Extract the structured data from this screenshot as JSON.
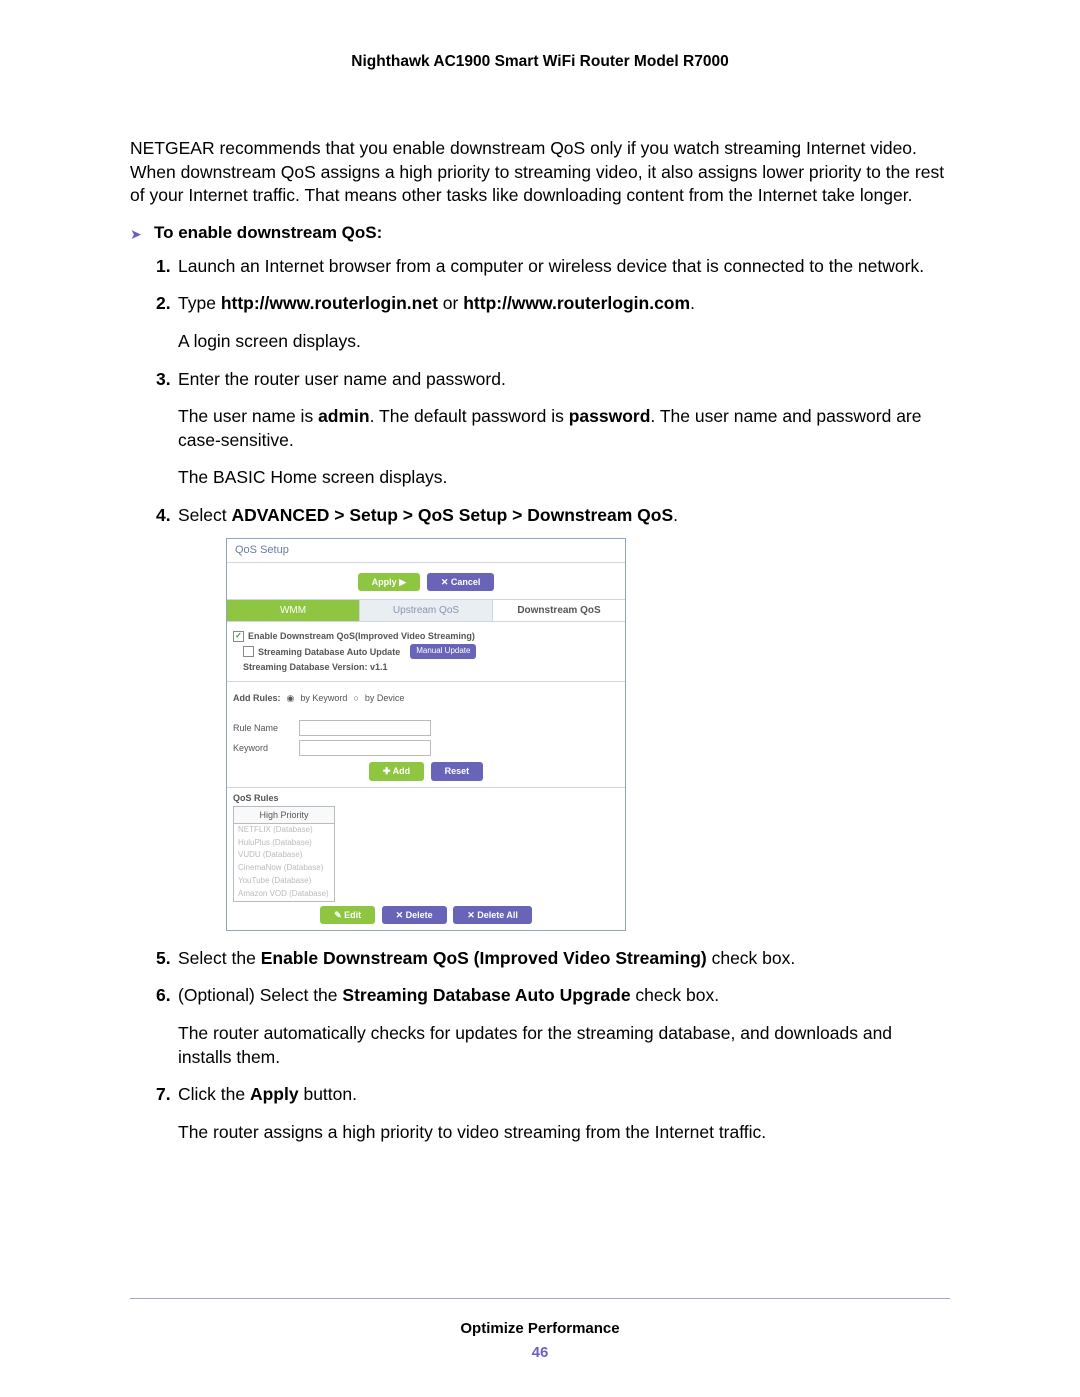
{
  "header": {
    "title": "Nighthawk AC1900 Smart WiFi Router Model R7000"
  },
  "intro": "NETGEAR recommends that you enable downstream QoS only if you watch streaming Internet video. When downstream QoS assigns a high priority to streaming video, it also assigns lower priority to the rest of your Internet traffic. That means other tasks like downloading content from the Internet take longer.",
  "subheading": "To enable downstream QoS:",
  "steps": {
    "s1": "Launch an Internet browser from a computer or wireless device that is connected to the network.",
    "s2_prefix": "Type ",
    "s2_bold1": "http://www.routerlogin.net",
    "s2_mid": " or ",
    "s2_bold2": "http://www.routerlogin.com",
    "s2_suffix": ".",
    "s2_p": "A login screen displays.",
    "s3": "Enter the router user name and password.",
    "s3_p1a": "The user name is ",
    "s3_p1b": "admin",
    "s3_p1c": ". The default password is ",
    "s3_p1d": "password",
    "s3_p1e": ". The user name and password are case-sensitive.",
    "s3_p2": "The BASIC Home screen displays.",
    "s4_prefix": "Select ",
    "s4_bold": "ADVANCED > Setup > QoS Setup > Downstream QoS",
    "s4_suffix": ".",
    "s5a": "Select the ",
    "s5b": "Enable Downstream QoS (Improved Video Streaming)",
    "s5c": " check box.",
    "s6a": "(Optional) Select the ",
    "s6b": "Streaming Database Auto Upgrade",
    "s6c": " check box.",
    "s6_p": "The router automatically checks for updates for the streaming database, and downloads and installs them.",
    "s7a": "Click the ",
    "s7b": "Apply",
    "s7c": " button.",
    "s7_p": "The router assigns a high priority to video streaming from the Internet traffic."
  },
  "screenshot": {
    "title": "QoS Setup",
    "apply": "Apply ▶",
    "cancel": "✕ Cancel",
    "tab1": "WMM",
    "tab2": "Upstream QoS",
    "tab3": "Downstream QoS",
    "chk1": "Enable Downstream QoS(Improved Video Streaming)",
    "chk2": "Streaming Database Auto Update",
    "manual_update": "Manual Update",
    "dbver": "Streaming Database Version: v1.1",
    "addrules": "Add Rules:",
    "bykeyword": "by Keyword",
    "bydevice": "by Device",
    "rulename": "Rule Name",
    "keyword": "Keyword",
    "add": "✚ Add",
    "reset": "Reset",
    "qosrules": "QoS Rules",
    "highpriority": "High Priority",
    "items": [
      "NETFLIX (Database)",
      "HuluPlus (Database)",
      "VUDU (Database)",
      "CinemaNow (Database)",
      "YouTube (Database)",
      "Amazon VOD (Database)"
    ],
    "edit": "✎ Edit",
    "delete": "✕ Delete",
    "deleteall": "✕ Delete All"
  },
  "footer": {
    "section": "Optimize Performance",
    "page": "46"
  }
}
